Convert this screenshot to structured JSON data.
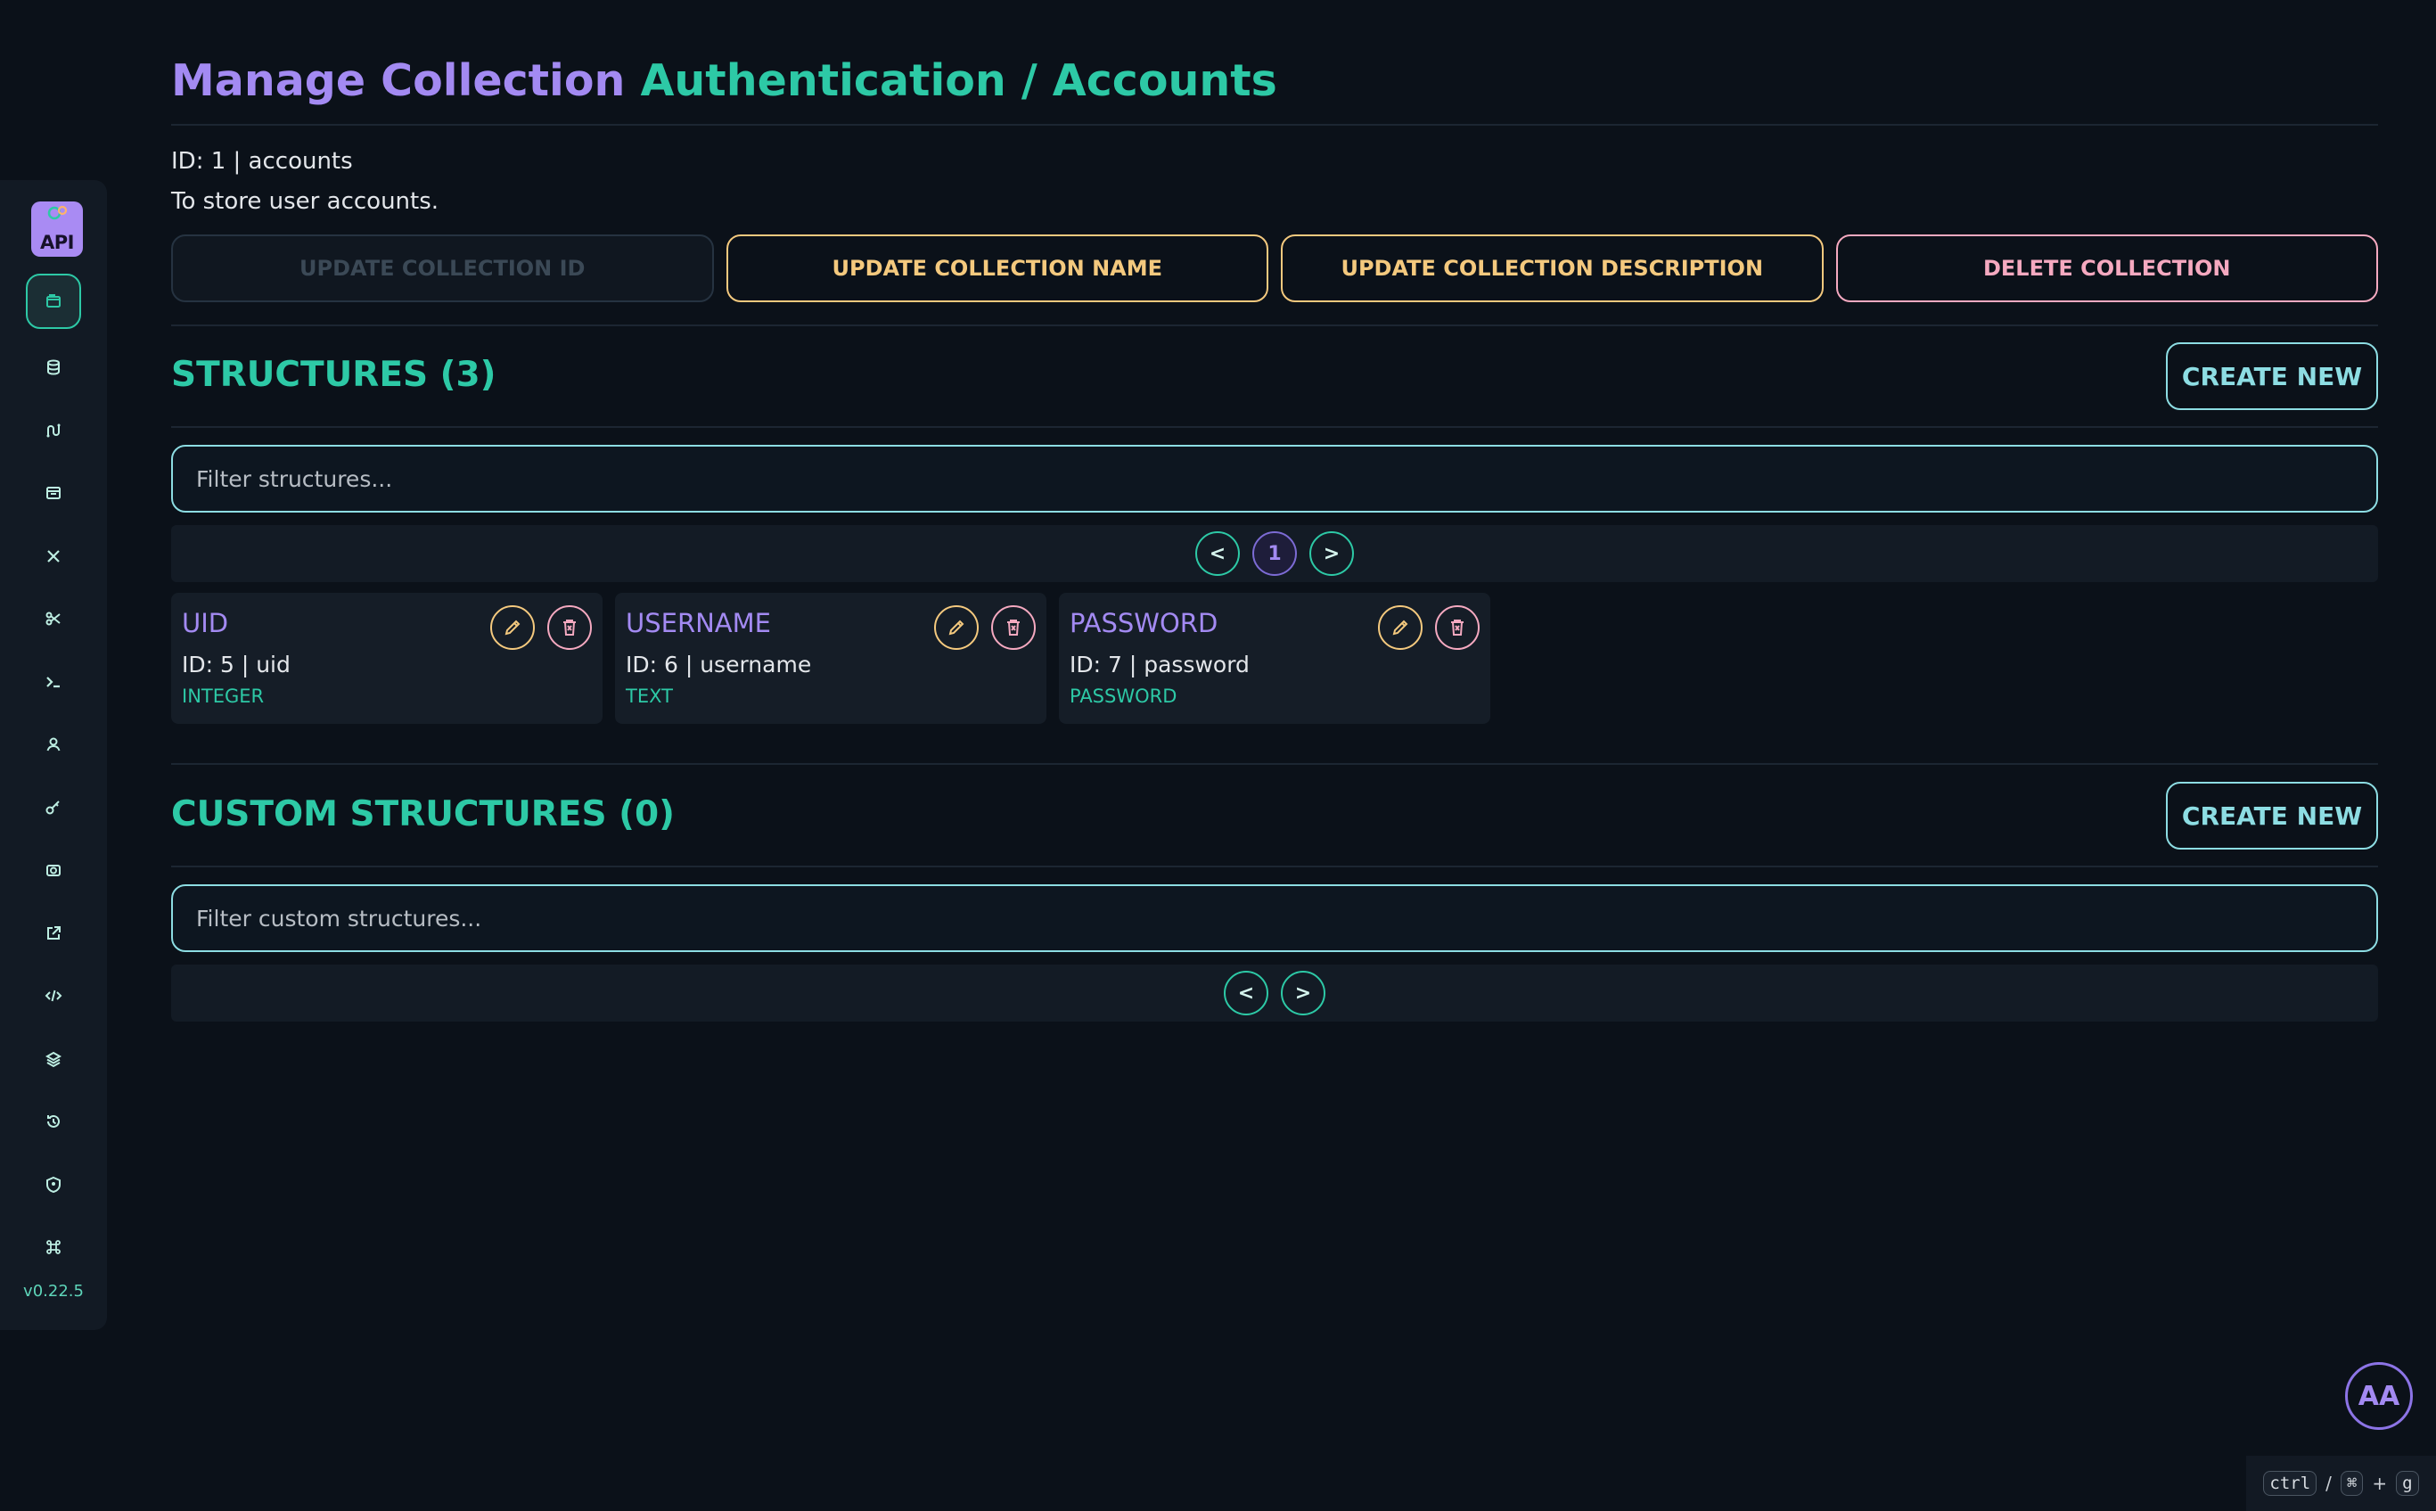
{
  "sidebar": {
    "logo_text": "API",
    "version": "v0.22.5",
    "items": [
      {
        "name": "collections-icon",
        "active": true
      },
      {
        "name": "database-icon"
      },
      {
        "name": "routes-icon"
      },
      {
        "name": "browser-window-icon"
      },
      {
        "name": "tools-icon"
      },
      {
        "name": "scissors-icon"
      },
      {
        "name": "terminal-icon"
      },
      {
        "name": "user-icon"
      },
      {
        "name": "key-icon"
      },
      {
        "name": "camera-icon"
      },
      {
        "name": "external-link-icon"
      },
      {
        "name": "code-icon"
      },
      {
        "name": "layers-icon"
      },
      {
        "name": "history-icon"
      },
      {
        "name": "user-shield-icon"
      },
      {
        "name": "shortcut-command-icon"
      }
    ]
  },
  "header": {
    "title_part1": "Manage Collection",
    "title_part2": "Authentication / Accounts"
  },
  "collection": {
    "id_line": "ID: 1 | accounts",
    "description": "To store user accounts."
  },
  "actions": {
    "update_id": "UPDATE COLLECTION ID",
    "update_name": "UPDATE COLLECTION NAME",
    "update_description": "UPDATE COLLECTION DESCRIPTION",
    "delete": "DELETE COLLECTION"
  },
  "structures": {
    "title": "STRUCTURES (3)",
    "create_label": "CREATE NEW",
    "filter_placeholder": "Filter structures...",
    "pager": {
      "prev": "<",
      "current": "1",
      "next": ">"
    },
    "items": [
      {
        "name": "UID",
        "id_line": "ID: 5 | uid",
        "type": "INTEGER"
      },
      {
        "name": "USERNAME",
        "id_line": "ID: 6 | username",
        "type": "TEXT"
      },
      {
        "name": "PASSWORD",
        "id_line": "ID: 7 | password",
        "type": "PASSWORD"
      }
    ]
  },
  "custom_structures": {
    "title": "CUSTOM STRUCTURES (0)",
    "create_label": "CREATE NEW",
    "filter_placeholder": "Filter custom structures...",
    "pager": {
      "prev": "<",
      "next": ">"
    }
  },
  "avatar": {
    "initials": "AA"
  },
  "shortcut": {
    "key1": "ctrl",
    "separator": "/",
    "key2": "⌘",
    "plus": "+",
    "key3": "g"
  },
  "colors": {
    "background": "#0b1119",
    "accent_teal": "#2dc9a6",
    "accent_purple": "#a38af2",
    "warning": "#f4c97e",
    "danger": "#f5a9c0",
    "create_border": "#8ddde3"
  }
}
